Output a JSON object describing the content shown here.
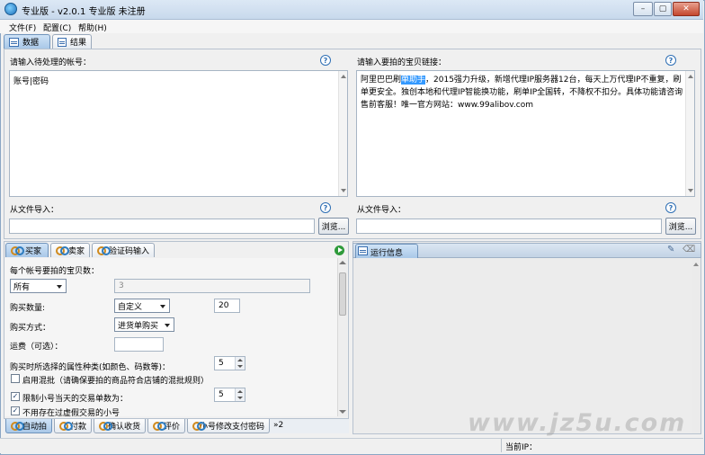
{
  "window": {
    "title": "专业版 - v2.0.1 专业版 未注册",
    "controls": {
      "minimize": "–",
      "maximize": "▢",
      "close": "✕"
    }
  },
  "menu": [
    {
      "label": "文件(F)"
    },
    {
      "label": "配置(C)"
    },
    {
      "label": "帮助(H)"
    }
  ],
  "main_tabs": [
    {
      "label": "数据",
      "active": true
    },
    {
      "label": "结果",
      "active": false
    }
  ],
  "accounts": {
    "label": "请输入待处理的帐号：",
    "content": "账号|密码",
    "import_label": "从文件导入：",
    "import_value": "",
    "browse_label": "浏览..."
  },
  "links": {
    "label": "请输入要拍的宝贝链接：",
    "content_before": "阿里巴巴刷",
    "content_selected": "单助手",
    "content_after": "，2015强力升级，新增代理IP服务器12台，每天上万代理IP不重复，刷单更安全。独创本地和代理IP智能换功能，刷单IP全国转，不降权不扣分。具体功能请咨询售前客服！唯一官方网站：www.99alibov.com",
    "import_label": "从文件导入：",
    "import_value": "",
    "browse_label": "浏览..."
  },
  "help_glyph": "?",
  "task_tabs": [
    {
      "label": "买家",
      "active": true
    },
    {
      "label": "卖家",
      "active": false
    },
    {
      "label": "验证码输入",
      "active": false
    }
  ],
  "form": {
    "items_per_account_label": "每个帐号要拍的宝贝数：",
    "items_per_account_select": "所有",
    "items_per_account_value": "3",
    "qty_label": "购买数量:",
    "qty_select": "自定义",
    "qty_value": "20",
    "method_label": "购买方式：",
    "method_select": "进货单购买",
    "shipping_label": "运费（可选）：",
    "shipping_value": "",
    "attr_label": "购买时所选择的属性种类(如颜色、码数等)：",
    "attr_value": "5",
    "mix_label": "启用混批（请确保要拍的商品符合店铺的混批规则）",
    "mix_checked": false,
    "limit_label": "限制小号当天的交易单数为：",
    "limit_checked": true,
    "limit_value": "5",
    "noexist_label": "不用存在过虚假交易的小号",
    "noexist_checked": true
  },
  "bottom_tabs": [
    {
      "label": "自动拍",
      "active": true
    },
    {
      "label": "付款",
      "active": false
    },
    {
      "label": "确认收货",
      "active": false
    },
    {
      "label": "评价",
      "active": false
    },
    {
      "label": "小号修改支付密码",
      "active": false
    },
    {
      "label": "»2",
      "active": false
    }
  ],
  "run_info": {
    "title": "运行信息"
  },
  "status": {
    "ip_label": "当前IP："
  },
  "watermark": "www.jz5u.com"
}
